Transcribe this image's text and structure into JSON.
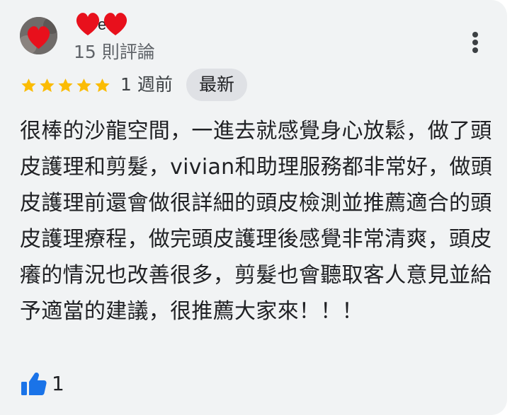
{
  "reviewer": {
    "review_count": "15 則評論"
  },
  "rating": {
    "stars": 5,
    "max": 5,
    "star_color": "#fbbc04"
  },
  "date": "1 週前",
  "badge": "最新",
  "review_text": "很棒的沙龍空間，一進去就感覺身心放鬆，做了頭皮護理和剪髮，vivian和助理服務都非常好，做頭皮護理前還會做很詳細的頭皮檢測並推薦適合的頭皮護理療程，做完頭皮護理後感覺非常清爽，頭皮癢的情況也改善很多，剪髮也會聽取客人意見並給予適當的建議，很推薦大家來！！！",
  "likes": {
    "count": "1",
    "icon": "thumbs-up-icon",
    "color": "#1a73e8"
  },
  "icons": {
    "more": "more-vert-icon",
    "privacy_mask": "red-heart-mask"
  },
  "colors": {
    "card_bg": "#f1f3f4",
    "mask_red": "#e8101c"
  }
}
